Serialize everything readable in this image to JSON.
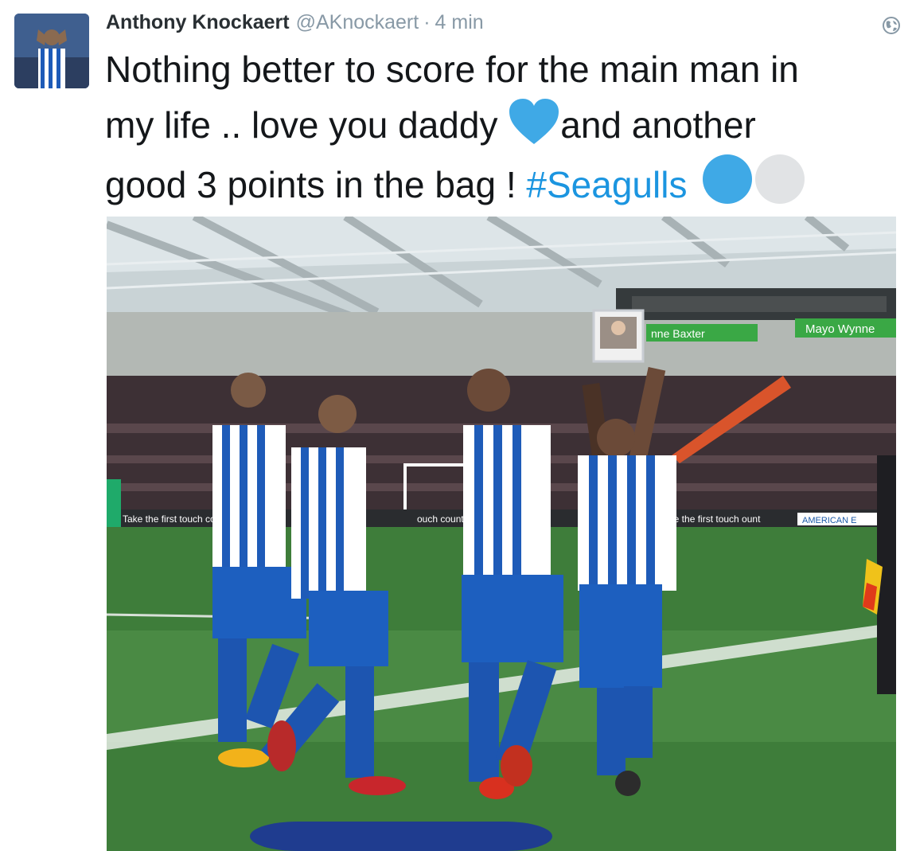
{
  "tweet": {
    "display_name": "Anthony Knockaert",
    "handle": "@AKnockaert",
    "separator": "·",
    "timestamp": "4 min",
    "text_line1": "Nothing better to score for the main man in",
    "text_line2a": "my life .. love you daddy ",
    "text_line2b": "and another",
    "text_line3a": "good 3 points in the bag ! ",
    "hashtag": "#Seagulls",
    "emoji": [
      "blue-heart",
      "large-blue-circle",
      "medium-white-circle"
    ],
    "hashtag_color": "#1b95e0"
  },
  "icons": {
    "globe": "globe-icon"
  },
  "photo": {
    "banner_left": "nne Baxter",
    "banner_right": "Mayo Wynne",
    "pitch_board_left": "Take the first touch count",
    "pitch_board_mid": "ouch count",
    "pitch_board_right": "ake the first touch ount",
    "pitch_board_far_right": "AMERICAN E",
    "jersey_color": "#0057b8"
  }
}
